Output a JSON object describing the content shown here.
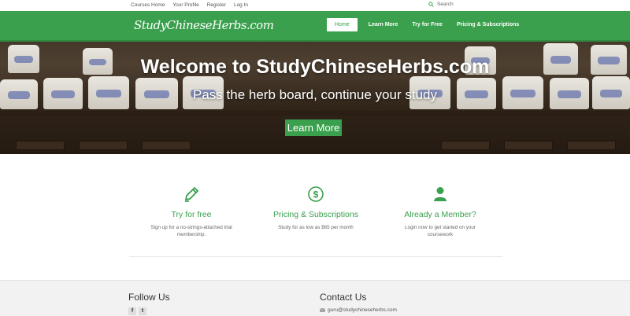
{
  "top_links": [
    "Courses Home",
    "Your Profile",
    "Register",
    "Log In"
  ],
  "search": {
    "label": "Search",
    "icon": "search-icon"
  },
  "nav": {
    "logo": "StudyChineseHerbs.com",
    "items": [
      "Home",
      "Learn More",
      "Try for Free",
      "Pricing & Subscriptions"
    ],
    "active": "Home"
  },
  "hero": {
    "title": "Welcome to StudyChineseHerbs.com",
    "subtitle": "Pass the herb board, continue your study",
    "button": "Learn More"
  },
  "features": [
    {
      "icon": "pencil-icon",
      "title": "Try for free",
      "text": "Sign up for a no-strings-attached trial membership."
    },
    {
      "icon": "dollar-icon",
      "title": "Pricing & Subscriptions",
      "text": "Study for as low as $65 per month"
    },
    {
      "icon": "user-icon",
      "title": "Already a Member?",
      "text": "Login now to get started on your coursework"
    }
  ],
  "footer": {
    "follow_title": "Follow Us",
    "social": [
      {
        "icon": "facebook-icon",
        "glyph": "f"
      },
      {
        "icon": "twitter-icon",
        "glyph": "t"
      }
    ],
    "contact_title": "Contact Us",
    "email": "guru@studychineseherbs.com"
  },
  "colors": {
    "brand_green": "#3aa04d",
    "footer_bg": "#f2f2f2"
  }
}
